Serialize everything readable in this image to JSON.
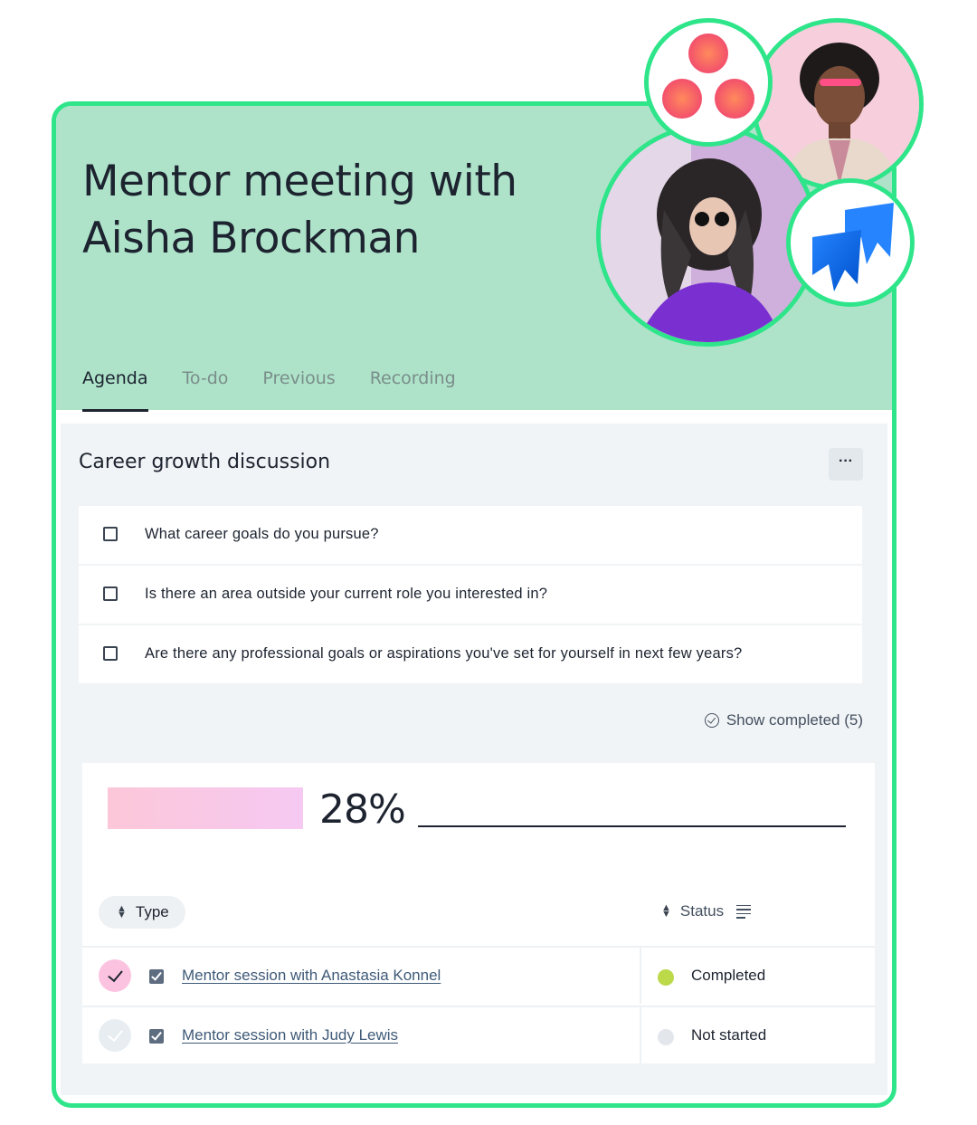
{
  "meeting": {
    "title_line1": "Mentor meeting with",
    "title_line2": "Aisha Brockman"
  },
  "tabs": [
    {
      "label": "Agenda",
      "active": true
    },
    {
      "label": "To-do",
      "active": false
    },
    {
      "label": "Previous",
      "active": false
    },
    {
      "label": "Recording",
      "active": false
    }
  ],
  "agenda": {
    "section_title": "Career growth discussion",
    "more_label": "···",
    "items": [
      {
        "text": "What career goals do you pursue?",
        "checked": false
      },
      {
        "text": "Is there an area outside your current role you interested in?",
        "checked": false
      },
      {
        "text": "Are there any professional goals or aspirations you've set for yourself in next few years?",
        "checked": false
      }
    ],
    "show_completed": "Show completed (5)"
  },
  "progress": {
    "percent_label": "28%",
    "value": 0.28
  },
  "table": {
    "col_type": "Type",
    "col_status": "Status",
    "rows": [
      {
        "title": "Mentor session with Anastasia Konnel",
        "status": "Completed",
        "done": true,
        "status_color": "#bcd94a"
      },
      {
        "title": "Mentor session with Judy Lewis",
        "status": "Not started",
        "done": false,
        "status_color": "#e3e7ec"
      }
    ]
  },
  "colors": {
    "accent_border": "#2ee58a",
    "header_bg": "#aee3ca",
    "asana_red": "#f45a6d",
    "jira_blue": "#2684ff"
  }
}
